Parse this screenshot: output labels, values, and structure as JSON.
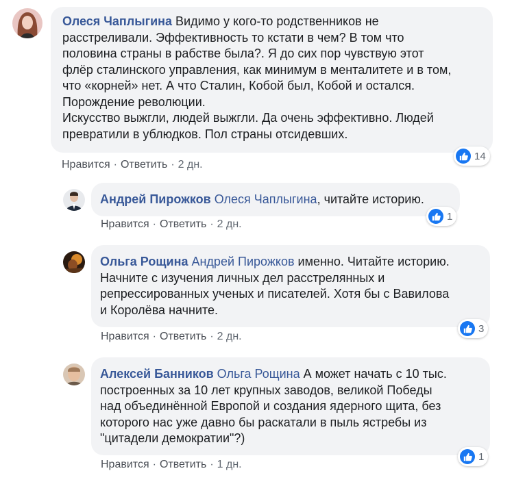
{
  "comments": [
    {
      "author": "Олеся Чаплыгина",
      "mention": "",
      "text": "Видимо у кого-то родственников не\nрасстреливали. Эффективность то кстати в чем? В том что\nполовина страны в рабстве была?. Я до сих пор чувствую этот\nфлёр сталинского управления, как минимум в менталитете и в том,\nчто «корней» нет. А что Сталин, Кобой был, Кобой и остался.\nПорождение революции.\nИскусство выжгли, людей выжгли. Да очень эффективно. Людей\nпревратили в ублюдков. Пол страны отсидевших.",
      "like": "Нравится",
      "reply": "Ответить",
      "time": "2 дн.",
      "reactions": "14"
    },
    {
      "author": "Андрей Пирожков",
      "mention": "Олеся Чаплыгина",
      "text": ", читайте историю.",
      "like": "Нравится",
      "reply": "Ответить",
      "time": "2 дн.",
      "reactions": "1"
    },
    {
      "author": "Ольга Рощина",
      "mention": "Андрей Пирожков",
      "text": " именно. Читайте историю.\nНачните с изучения личных дел расстрелянных и\nрепрессированных ученых и писателей. Хотя бы с Вавилова\nи Королёва начните.",
      "like": "Нравится",
      "reply": "Ответить",
      "time": "2 дн.",
      "reactions": "3"
    },
    {
      "author": "Алексей Банников",
      "mention": "Ольга Рощина",
      "text": " А может начать с 10 тыс.\nпостроенных за 10 лет крупных заводов, великой Победы\nнад объединённой Европой и создания ядерного щита, без\nкоторого нас уже давно бы раскатали в пыль ястребы из\n\"цитадели демократии\"?)",
      "like": "Нравится",
      "reply": "Ответить",
      "time": "1 дн.",
      "reactions": "1"
    }
  ],
  "icons": {
    "like_icon": "thumbs-up-icon",
    "like_color": "#1877f2"
  }
}
